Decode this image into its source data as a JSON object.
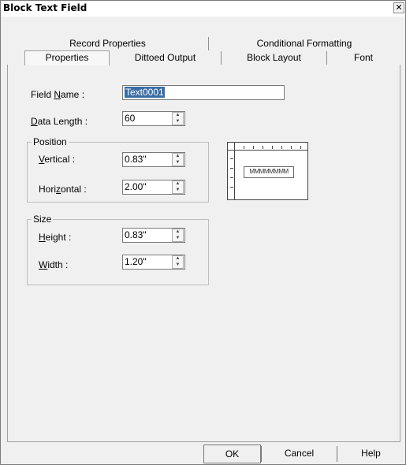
{
  "window": {
    "title": "Block Text Field",
    "close_glyph": "✕"
  },
  "tabs_back": [
    {
      "label": "Record Properties"
    },
    {
      "label": "Conditional Formatting"
    }
  ],
  "tabs_front": [
    {
      "label": "Properties",
      "active": true
    },
    {
      "label": "Dittoed Output"
    },
    {
      "label": "Block Layout"
    },
    {
      "label": "Font"
    }
  ],
  "properties": {
    "field_name": {
      "prefix": "Field ",
      "mnemonic": "N",
      "suffix": "ame :",
      "value": "Text0001"
    },
    "data_length": {
      "mnemonic": "D",
      "suffix": "ata Length :",
      "value": "60"
    },
    "position": {
      "group_label": "Position",
      "vertical": {
        "mnemonic": "V",
        "suffix": "ertical :",
        "value": "0.83\""
      },
      "horizontal": {
        "prefix": "Hori",
        "mnemonic": "z",
        "suffix": "ontal :",
        "value": "2.00\""
      }
    },
    "size": {
      "group_label": "Size",
      "height": {
        "mnemonic": "H",
        "suffix": "eight :",
        "value": "0.83\""
      },
      "width": {
        "mnemonic": "W",
        "suffix": "idth :",
        "value": "1.20\""
      }
    },
    "preview_sample": "MMMMMMMM"
  },
  "buttons": {
    "ok": "OK",
    "cancel": "Cancel",
    "help": "Help"
  },
  "colors": {
    "selection": "#3a6ea5",
    "dialog_bg": "#f0f0f0"
  },
  "icons": {
    "spin_up": "▲",
    "spin_down": "▼"
  }
}
